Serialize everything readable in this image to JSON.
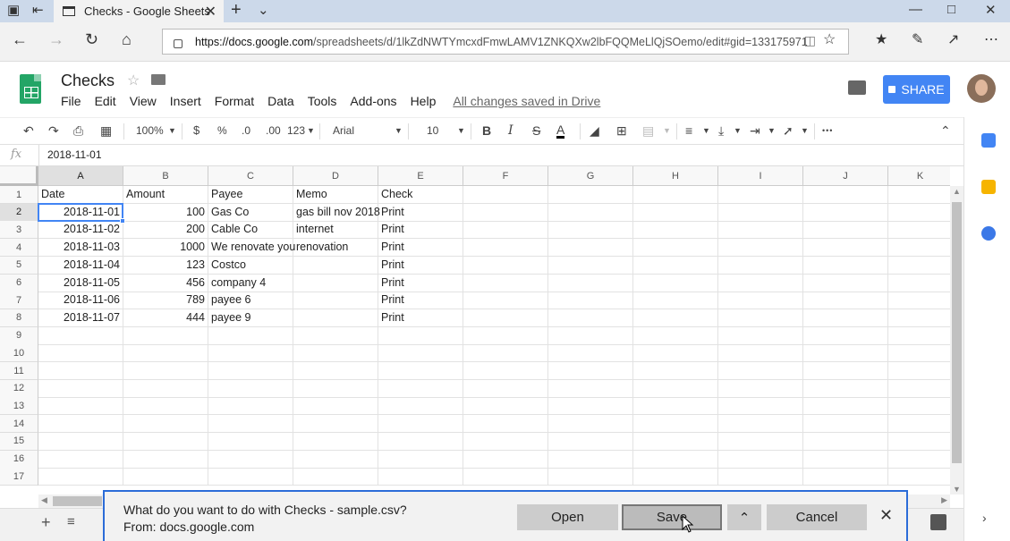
{
  "browser": {
    "tab_title": "Checks - Google Sheets",
    "url_domain": "https://docs.google.com",
    "url_path": "/spreadsheets/d/1lkZdNWTYmcxdFmwLAMV1ZNKQXw2lbFQQMeLlQjSOemo/edit#gid=133175971",
    "icons": [
      "tab-manager-icon",
      "back-tab-icon",
      "new-tab-icon",
      "tab-list-icon",
      "back-icon",
      "forward-icon",
      "refresh-icon",
      "home-icon",
      "lock-icon",
      "reading-view-icon",
      "favorite-star-icon",
      "favorites-hub-icon",
      "pen-icon",
      "share-icon",
      "more-icon"
    ]
  },
  "app": {
    "doc_title": "Checks",
    "menu": [
      "File",
      "Edit",
      "View",
      "Insert",
      "Format",
      "Data",
      "Tools",
      "Add-ons",
      "Help"
    ],
    "saved_status": "All changes saved in Drive",
    "share_label": "SHARE"
  },
  "toolbar": {
    "zoom": "100%",
    "currency": "$",
    "percent": "%",
    "dec_less": ".0",
    "dec_more": ".00",
    "format_more": "123",
    "font": "Arial",
    "font_size": "10",
    "bold": "B",
    "italic": "I",
    "strike": "S",
    "text_color": "A",
    "more": "•••"
  },
  "formula_bar": {
    "fx": "fx",
    "value": "2018-11-01"
  },
  "grid": {
    "columns": [
      "A",
      "B",
      "C",
      "D",
      "E",
      "F",
      "G",
      "H",
      "I",
      "J",
      "K"
    ],
    "rows": [
      "1",
      "2",
      "3",
      "4",
      "5",
      "6",
      "7",
      "8",
      "9",
      "10",
      "11",
      "12",
      "13",
      "14",
      "15",
      "16",
      "17"
    ],
    "cells": [
      [
        "Date",
        "Amount",
        "Payee",
        "Memo",
        "Check"
      ],
      [
        "2018-11-01",
        "100",
        "Gas Co",
        "gas bill nov 2018",
        "Print"
      ],
      [
        "2018-11-02",
        "200",
        "Cable Co",
        "internet",
        "Print"
      ],
      [
        "2018-11-03",
        "1000",
        "We renovate you",
        "renovation",
        "Print"
      ],
      [
        "2018-11-04",
        "123",
        "Costco",
        "",
        "Print"
      ],
      [
        "2018-11-05",
        "456",
        "company 4",
        "",
        "Print"
      ],
      [
        "2018-11-06",
        "789",
        "payee 6",
        "",
        "Print"
      ],
      [
        "2018-11-07",
        "444",
        "payee 9",
        "",
        "Print"
      ]
    ]
  },
  "download": {
    "question": "What do you want to do with Checks - sample.csv?",
    "from": "From: docs.google.com",
    "open": "Open",
    "save": "Save",
    "cancel": "Cancel"
  },
  "colors": {
    "accent": "#4285f4",
    "sheets_green": "#23a566",
    "title_bar": "#ccd9ea"
  }
}
